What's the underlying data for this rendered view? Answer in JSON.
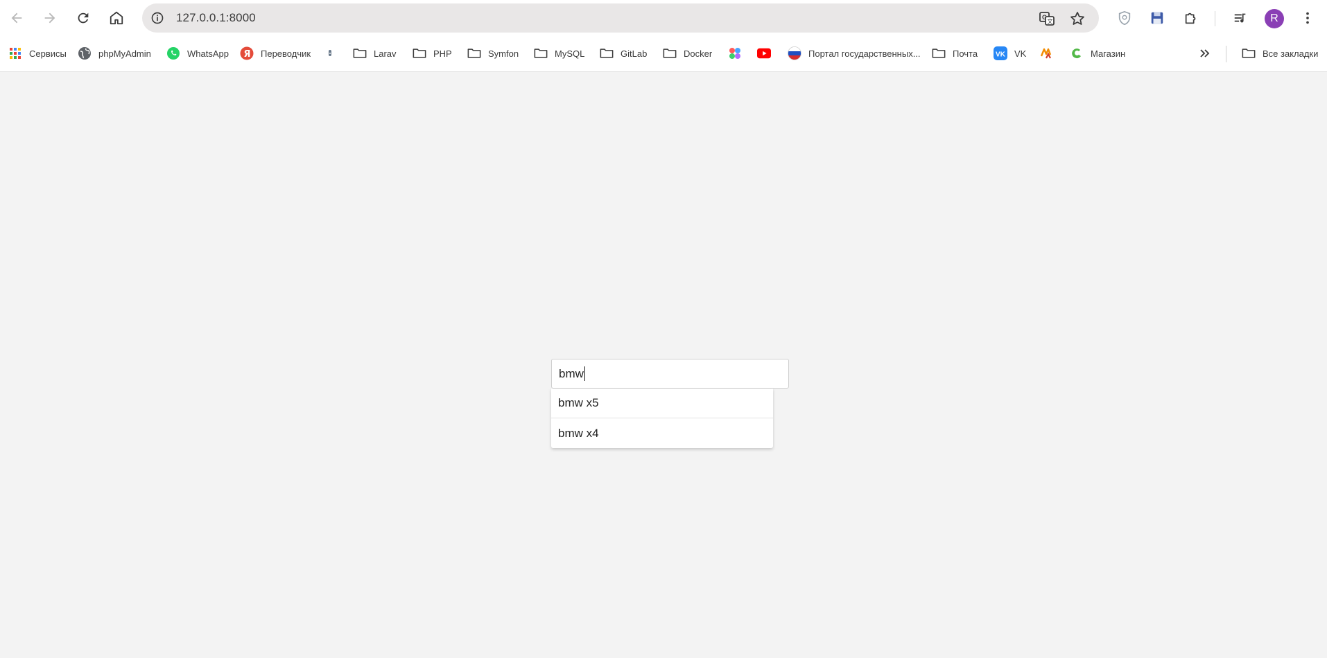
{
  "browser": {
    "url": "127.0.0.1:8000",
    "avatar_letter": "R",
    "icons": [
      "back-icon",
      "forward-icon",
      "reload-icon",
      "home-icon",
      "site-info-icon",
      "translate-icon",
      "bookmark-star-icon",
      "shield-extension-icon",
      "save-extension-icon",
      "extensions-puzzle-icon",
      "media-queue-icon",
      "menu-dots-icon"
    ]
  },
  "bookmarks": {
    "items": [
      {
        "label": "Сервисы",
        "icon": "apps-grid-icon"
      },
      {
        "label": "phpMyAdmin",
        "icon": "globe-icon"
      },
      {
        "label": "WhatsApp",
        "icon": "whatsapp-icon"
      },
      {
        "label": "Переводчик",
        "icon": "yandex-translate-icon"
      },
      {
        "label": "",
        "icon": "pin-icon"
      },
      {
        "label": "Larav",
        "icon": "folder-icon"
      },
      {
        "label": "PHP",
        "icon": "folder-icon"
      },
      {
        "label": "Symfon",
        "icon": "folder-icon"
      },
      {
        "label": "MySQL",
        "icon": "folder-icon"
      },
      {
        "label": "GitLab",
        "icon": "folder-icon"
      },
      {
        "label": "Docker",
        "icon": "folder-icon"
      },
      {
        "label": "",
        "icon": "colorful-dots-icon"
      },
      {
        "label": "",
        "icon": "youtube-icon"
      },
      {
        "label": "Портал государственных...",
        "icon": "russia-flag-icon"
      },
      {
        "label": "Почта",
        "icon": "folder-icon"
      },
      {
        "label": "VK",
        "icon": "vk-icon"
      },
      {
        "label": "",
        "icon": "wildberries-icon"
      },
      {
        "label": "Магазин",
        "icon": "shop-icon"
      }
    ],
    "more_icon": "chevron-double-right-icon",
    "all_bookmarks": "Все закладки"
  },
  "colors": {
    "page_bg": "#f3f3f3",
    "avatar": "#8a3fb5",
    "omnibox": "#e9e7e7"
  },
  "search": {
    "value": "bmw",
    "suggestions": [
      "bmw x5",
      "bmw x4"
    ]
  }
}
